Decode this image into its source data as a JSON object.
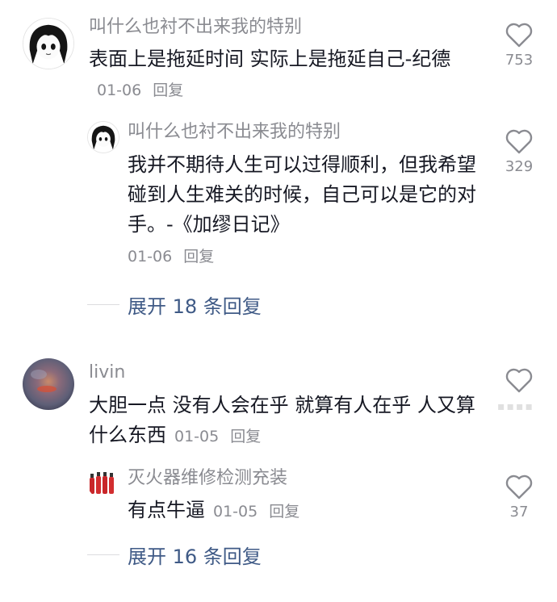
{
  "comments": [
    {
      "username": "叫什么也衬不出来我的特别",
      "text": "表面上是拖延时间 实际上是拖延自己-纪德",
      "date": "01-06",
      "reply_label": "回复",
      "likes": "753",
      "replies": [
        {
          "username": "叫什么也衬不出来我的特别",
          "text": "我并不期待人生可以过得顺利，但我希望碰到人生难关的时候，自己可以是它的对手。-《加缪日记》",
          "date": "01-06",
          "reply_label": "回复",
          "likes": "329"
        }
      ],
      "expand_label": "展开 18 条回复"
    },
    {
      "username": "livin",
      "text": "大胆一点 没有人会在乎 就算有人在乎 人又算什么东西",
      "date": "01-05",
      "reply_label": "回复",
      "likes": "",
      "replies": [
        {
          "username": "灭火器维修检测充装",
          "text": "有点牛逼",
          "date": "01-05",
          "reply_label": "回复",
          "likes": "37"
        }
      ],
      "expand_label": "展开 16 条回复"
    }
  ],
  "icons": {
    "like": "heart-outline-icon"
  },
  "colors": {
    "text": "#161823",
    "secondary": "#8a8b91",
    "link": "#3f5a86"
  }
}
